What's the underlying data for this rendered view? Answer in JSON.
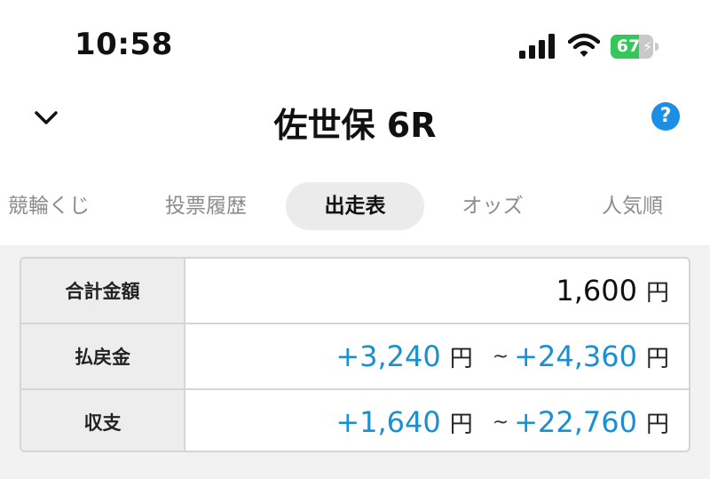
{
  "status_bar": {
    "time": "10:58",
    "battery_percent": "67",
    "battery_level": 0.67,
    "icons": [
      "signal-icon",
      "wifi-icon",
      "battery-icon"
    ]
  },
  "nav": {
    "title": "佐世保 6R",
    "back_icon": "chevron-down-icon",
    "help_label": "?"
  },
  "tabs": [
    {
      "label": "競輪くじ",
      "active": false
    },
    {
      "label": "投票履歴",
      "active": false
    },
    {
      "label": "出走表",
      "active": true
    },
    {
      "label": "オッズ",
      "active": false
    },
    {
      "label": "人気順",
      "active": false
    }
  ],
  "summary": {
    "rows": [
      {
        "label": "合計金額",
        "value": "1,600",
        "unit": "円"
      },
      {
        "label": "払戻金",
        "min": "+3,240",
        "min_unit": "円",
        "tilde": "~",
        "max": "+24,360",
        "max_unit": "円"
      },
      {
        "label": "収支",
        "min": "+1,640",
        "min_unit": "円",
        "tilde": "~",
        "max": "+22,760",
        "max_unit": "円"
      }
    ]
  },
  "colors": {
    "accent_blue": "#1a8fd1",
    "battery_green": "#34c759",
    "help_blue": "#1a8fe3"
  }
}
